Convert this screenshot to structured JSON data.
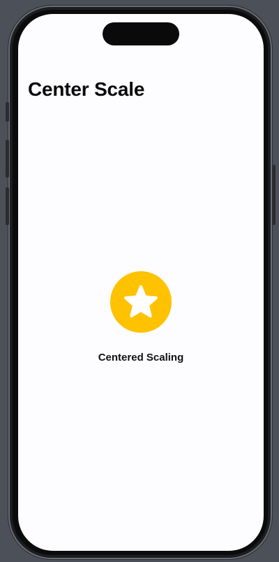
{
  "screen": {
    "title": "Center Scale",
    "caption": "Centered Scaling"
  },
  "icon": {
    "name": "star-icon",
    "badge_color": "#fec200",
    "glyph_color": "#ffffff"
  }
}
